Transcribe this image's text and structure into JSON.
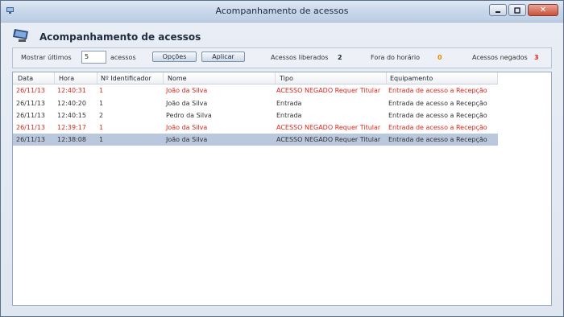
{
  "window": {
    "title": "Acompanhamento de acessos",
    "close_label": "✕"
  },
  "header": {
    "title": "Acompanhamento de acessos"
  },
  "filter": {
    "show_label": "Mostrar últimos",
    "count_value": "5",
    "unit_label": "acessos",
    "options_button": "Opções",
    "apply_button": "Aplicar",
    "granted_label": "Acessos liberados",
    "granted_count": "2",
    "offhours_label": "Fora do horário",
    "offhours_count": "0",
    "denied_label": "Acessos negados",
    "denied_count": "3"
  },
  "colors": {
    "denied": "#e0241b",
    "offhours": "#e08a00",
    "selected": "#b9c8dc"
  },
  "table": {
    "columns": [
      "Data",
      "Hora",
      "Nº Identificador",
      "Nome",
      "Tipo",
      "Equipamento"
    ],
    "rows": [
      {
        "status": "denied",
        "cells": [
          "26/11/13",
          "12:40:31",
          "1",
          "João da Silva",
          "ACESSO  NEGADO Requer Titular",
          "Entrada de acesso a Recepção"
        ]
      },
      {
        "status": "ok",
        "cells": [
          "26/11/13",
          "12:40:20",
          "1",
          "João da Silva",
          "Entrada",
          "Entrada de acesso a Recepção"
        ]
      },
      {
        "status": "ok",
        "cells": [
          "26/11/13",
          "12:40:15",
          "2",
          "Pedro da Silva",
          "Entrada",
          "Entrada de acesso a Recepção"
        ]
      },
      {
        "status": "denied",
        "cells": [
          "26/11/13",
          "12:39:17",
          "1",
          "João da Silva",
          "ACESSO  NEGADO Requer Titular",
          "Entrada de acesso a Recepção"
        ]
      },
      {
        "status": "selected",
        "cells": [
          "26/11/13",
          "12:38:08",
          "1",
          "João da Silva",
          "ACESSO  NEGADO Requer Titular",
          "Entrada de acesso a Recepção"
        ]
      }
    ]
  }
}
